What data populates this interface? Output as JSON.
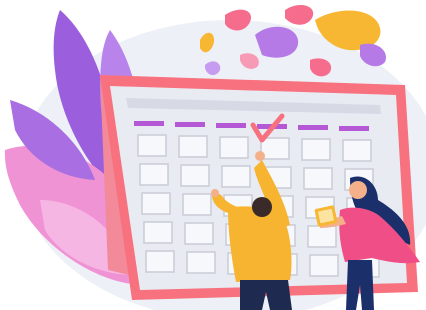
{
  "illustration": {
    "subject": "calendar-event-planning",
    "colors": {
      "calendar_frame": "#f7727e",
      "calendar_board": "#e9ebf3",
      "calendar_cell": "#f7f8fc",
      "cell_outline": "#c9cbd6",
      "weekday_bar": "#b458d6",
      "check_mark": "#f7727e",
      "leaf_purple": "#8f56d8",
      "leaf_pink": "#f093d4",
      "confetti_yellow": "#f8b733",
      "confetti_pink": "#f56c8c",
      "confetti_purple": "#b67ae6",
      "man_shirt": "#f7b430",
      "man_pants": "#1e2a4f",
      "woman_top": "#ef4e86",
      "woman_hair": "#1b2f6b",
      "skin": "#f3b08b",
      "backdrop": "#eef0f7"
    }
  }
}
